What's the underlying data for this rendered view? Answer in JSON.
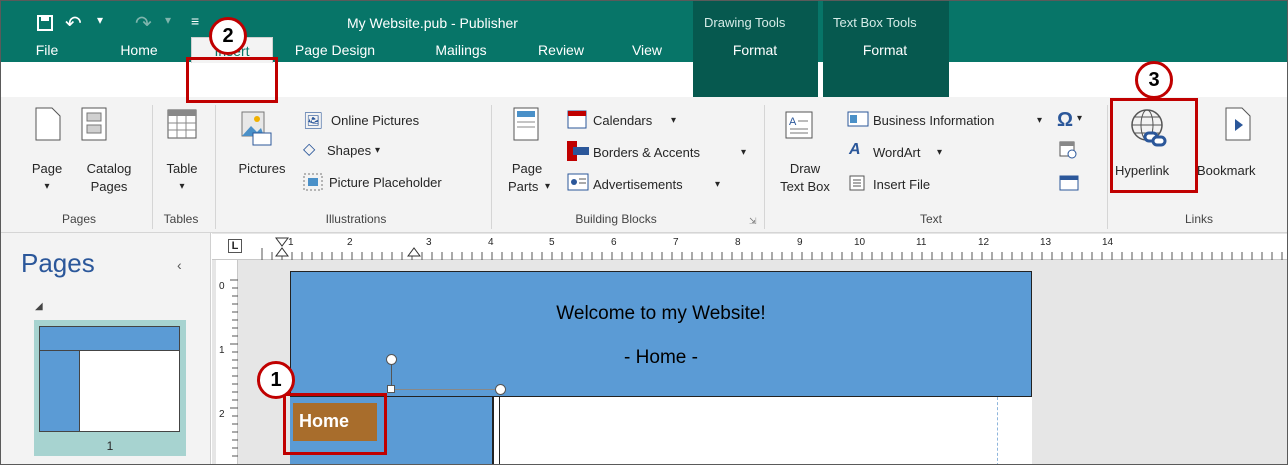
{
  "title": "My Website.pub - Publisher",
  "contextual": {
    "drawing_tools": "Drawing Tools",
    "text_box_tools": "Text Box Tools"
  },
  "tabs": [
    "File",
    "Home",
    "Insert",
    "Page Design",
    "Mailings",
    "Review",
    "View",
    "Format",
    "Format"
  ],
  "ribbon": {
    "pages": {
      "page": "Page",
      "catalog_pages_1": "Catalog",
      "catalog_pages_2": "Pages",
      "group": "Pages"
    },
    "tables": {
      "table": "Table",
      "group": "Tables"
    },
    "illustrations": {
      "pictures": "Pictures",
      "online_pictures": "Online Pictures",
      "shapes": "Shapes",
      "picture_placeholder": "Picture Placeholder",
      "group": "Illustrations"
    },
    "building_blocks": {
      "page_parts_1": "Page",
      "page_parts_2": "Parts",
      "calendars": "Calendars",
      "borders_accents": "Borders & Accents",
      "advertisements": "Advertisements",
      "group": "Building Blocks"
    },
    "text": {
      "draw_text_box_1": "Draw",
      "draw_text_box_2": "Text Box",
      "business_information": "Business Information",
      "wordart": "WordArt",
      "insert_file": "Insert File",
      "group": "Text"
    },
    "links": {
      "hyperlink": "Hyperlink",
      "bookmark": "Bookmark",
      "group": "Links"
    }
  },
  "callouts": [
    "1",
    "2",
    "3"
  ],
  "pages_pane": {
    "title": "Pages",
    "thumb_number": "1"
  },
  "ruler": {
    "corner": "L",
    "h_numbers": [
      "1",
      "2",
      "3",
      "4",
      "5",
      "6",
      "7",
      "8",
      "9",
      "10",
      "11",
      "12",
      "13",
      "14"
    ],
    "v_numbers": [
      "0",
      "1",
      "2"
    ]
  },
  "document": {
    "heading": "Welcome to my Website!",
    "subheading": "- Home -",
    "home_button": "Home"
  },
  "colors": {
    "titlebar": "#077568",
    "accent_red": "#c00000",
    "header_blue": "#5b9bd5",
    "home_brown": "#a86d2c"
  }
}
